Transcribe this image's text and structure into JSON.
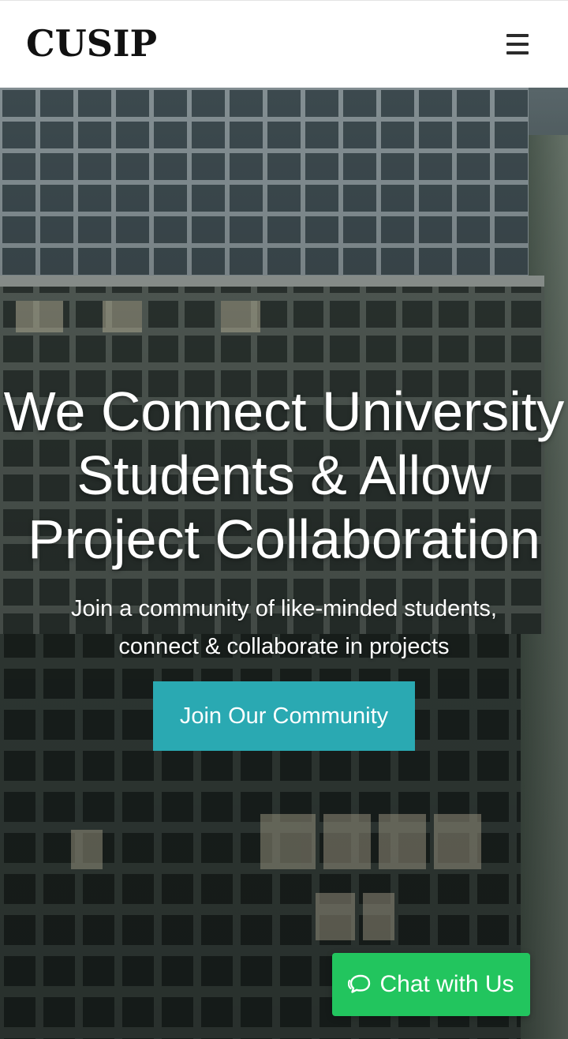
{
  "header": {
    "logo": "CUSIP",
    "menu_icon": "hamburger-menu-icon"
  },
  "hero": {
    "headline_lines": [
      "We Connect University",
      "Students & Allow",
      "Project Collaboration"
    ],
    "subtext_lines": [
      "Join a community of like-minded students,",
      "connect & collaborate in projects"
    ],
    "cta_label": "Join Our Community"
  },
  "chat": {
    "label": "Chat with Us",
    "icon": "chat-bubbles-icon"
  },
  "colors": {
    "cta": "#2aa9b2",
    "chat": "#22c55e",
    "header_bg": "#ffffff",
    "logo": "#111111"
  }
}
